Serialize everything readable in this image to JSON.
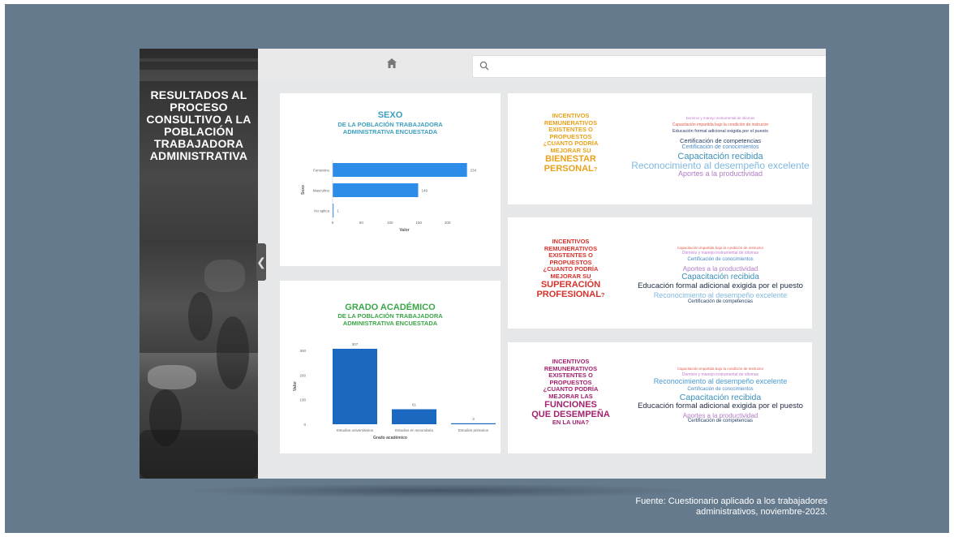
{
  "sidebar": {
    "title": "RESULTADOS AL PROCESO CONSULTIVO A LA POBLACIÓN TRABAJADORA ADMINISTRATIVA",
    "toggle": "❮"
  },
  "topbar": {
    "search_placeholder": ""
  },
  "sexo_card": {
    "title": "SEXO",
    "subtitle": "DE LA POBLACIÓN TRABAJADORA ADMINISTRATIVA ENCUESTADA",
    "color": "#3b9fbf"
  },
  "grado_card": {
    "title": "GRADO ACADÉMICO",
    "subtitle": "DE LA POBLACIÓN TRABAJADORA ADMINISTRATIVA ENCUESTADA",
    "color": "#3aa648"
  },
  "chart_data": [
    {
      "type": "bar",
      "orientation": "horizontal",
      "categories": [
        "Femenino",
        "Masculino",
        "No aplica"
      ],
      "values": [
        234,
        149,
        1
      ],
      "data_labels": [
        "234",
        "149",
        "1"
      ],
      "xlabel": "Valor",
      "ylabel": "Sexo",
      "xlim": [
        0,
        250
      ],
      "xticks": [
        "0",
        "50",
        "100",
        "150",
        "200"
      ],
      "color": "#2d8ce8"
    },
    {
      "type": "bar",
      "orientation": "vertical",
      "categories": [
        "Estudios universitarios",
        "Estudios en secundaria",
        "Estudios primarios"
      ],
      "values": [
        307,
        61,
        3
      ],
      "data_labels": [
        "307",
        "61",
        "3"
      ],
      "xlabel": "Grado académico",
      "ylabel": "Valor",
      "ylim": [
        0,
        320
      ],
      "yticks": [
        "0",
        "100",
        "200",
        "300"
      ],
      "color": "#1b68c0"
    }
  ],
  "panels": [
    {
      "question_lines": [
        "INCENTIVOS",
        "REMUNERATIVOS",
        "EXISTENTES O",
        "PROPUESTOS",
        "¿CUANTO PODRÍA",
        "MEJORAR SU"
      ],
      "emphasis_lines": [
        "BIENESTAR",
        "PERSONAL"
      ],
      "suffix": "?",
      "color": "#e8a11a",
      "words": [
        {
          "text": "Dominio y manejo instrumental de idiomas",
          "color": "#c47bd0"
        },
        {
          "text": "Capacitación impartida bajo la condición de instructor",
          "color": "#e05a4c"
        },
        {
          "text": "Educación formal adicional exigida por el puesto",
          "color": "#2a3a66"
        },
        {
          "text": "Certificación de competencias",
          "color": "#1f3a5f"
        },
        {
          "text": "Certificación de conocimientos",
          "color": "#4a8ac4"
        },
        {
          "text": "Capacitación recibida",
          "color": "#3a8fb8"
        },
        {
          "text": "Reconocimiento al desempeño excelente",
          "color": "#7fb8e0"
        },
        {
          "text": "Aportes a la productividad",
          "color": "#b07cc6"
        }
      ]
    },
    {
      "question_lines": [
        "INCENTIVOS",
        "REMUNERATIVOS",
        "EXISTENTES O",
        "PROPUESTOS",
        "¿CUANTO PODRÍA",
        "MEJORAR SU"
      ],
      "emphasis_lines": [
        "SUPERACIÓN",
        "PROFESIONAL"
      ],
      "suffix": "?",
      "color": "#d8322c",
      "words": [
        {
          "text": "Capacitación impartida bajo la condición de instructor",
          "color": "#e05a4c"
        },
        {
          "text": "Dominio y manejo instrumental de idiomas",
          "color": "#c47bd0"
        },
        {
          "text": "Certificación de conocimientos",
          "color": "#4a8ac4"
        },
        {
          "text": "Aportes a la productividad",
          "color": "#b07cc6"
        },
        {
          "text": "Capacitación recibida",
          "color": "#3a8fb8"
        },
        {
          "text": "Educación formal adicional exigida por el puesto",
          "color": "#1e2a44"
        },
        {
          "text": "Reconocimiento al desempeño excelente",
          "color": "#7fb8e0"
        },
        {
          "text": "Certificación de competencias",
          "color": "#1f3a5f"
        }
      ]
    },
    {
      "question_lines": [
        "INCENTIVOS",
        "REMUNERATIVOS",
        "EXISTENTES O",
        "PROPUESTOS",
        "¿CUANTO PODRÍA",
        "MEJORAR LAS"
      ],
      "emphasis_lines": [
        "FUNCIONES",
        "QUE DESEMPEÑA"
      ],
      "suffix_line": "EN LA UNA?",
      "color": "#a5226f",
      "words": [
        {
          "text": "Capacitación impartida bajo la condición de instructor",
          "color": "#e05a4c"
        },
        {
          "text": "Dominio y manejo instrumental de idiomas",
          "color": "#c47bd0"
        },
        {
          "text": "Reconocimiento al desempeño excelente",
          "color": "#4a9ad0"
        },
        {
          "text": "Certificación de conocimientos",
          "color": "#4a8ac4"
        },
        {
          "text": "Capacitación recibida",
          "color": "#3a8fb8"
        },
        {
          "text": "Educación formal adicional exigida por el puesto",
          "color": "#1e2a44"
        },
        {
          "text": "Aportes a la productividad",
          "color": "#b07cc6"
        },
        {
          "text": "Certificación de competencias",
          "color": "#1f3a5f"
        }
      ]
    }
  ],
  "source": {
    "line1": "Fuente: Cuestionario aplicado a los trabajadores",
    "line2": "administrativos, noviembre-2023."
  },
  "colors": {
    "background": "#667a8e",
    "frame": "#e6e7e8"
  }
}
